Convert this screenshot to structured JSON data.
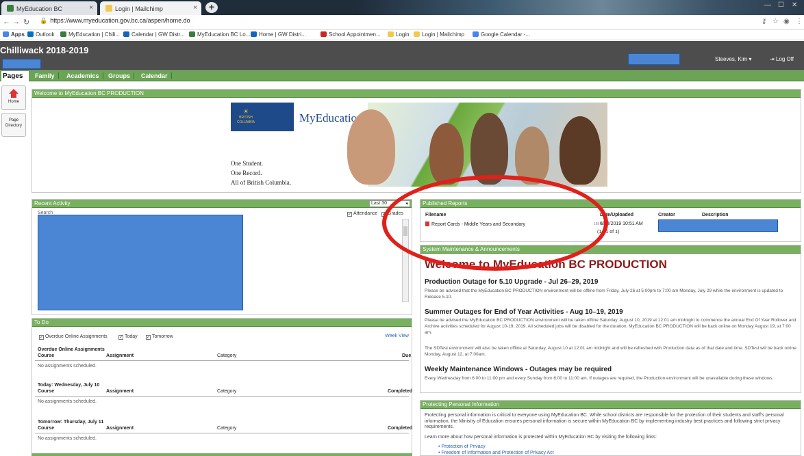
{
  "browser": {
    "tabs": [
      {
        "title": "MyEducation BC"
      },
      {
        "title": "Login | Mailchimp"
      }
    ],
    "url": "https://www.myeducation.gov.bc.ca/aspen/home.do",
    "bookmarks": [
      "Apps",
      "Outlook",
      "MyEducation | Chili...",
      "Calendar | GW Distr...",
      "MyEducation BC Lo...",
      "Home | GW Distri...",
      "School Appointmen...",
      "Login",
      "Login | Mailchimp",
      "Google Calendar -..."
    ]
  },
  "app": {
    "school": "Chilliwack 2018-2019",
    "user": "Steeves, Kim ▾",
    "logoff": "Log Off",
    "pages_label": "Pages",
    "top_tabs": [
      "Family",
      "Academics",
      "Groups",
      "Calendar"
    ],
    "side": {
      "home": "Home",
      "directory_1": "Page",
      "directory_2": "Directory"
    }
  },
  "welcome": {
    "header": "Welcome to MyEducation BC PRODUCTION",
    "brand": "MyEducationBC",
    "logo_text": "BRITISH COLUMBIA",
    "tagline": [
      "One Student.",
      "One Record.",
      "All of British Columbia."
    ]
  },
  "recent": {
    "header": "Recent Activity",
    "select": "Last 30",
    "search": "Search",
    "attendance": "Attendance",
    "grades": "Grades"
  },
  "todo": {
    "header": "To Do",
    "filters": [
      "Overdue Online Assignments",
      "Today",
      "Tomorrow"
    ],
    "week_view": "Week View",
    "sections": [
      {
        "title": "Overdue Online Assignments",
        "cols": [
          "Course",
          "Assignment",
          "Category",
          "Due"
        ],
        "empty": "No assignments scheduled."
      },
      {
        "title": "Today: Wednesday, July 10",
        "cols": [
          "Course",
          "Assignment",
          "Category",
          "Completed"
        ],
        "empty": "No assignments scheduled."
      },
      {
        "title": "Tomorrow: Thursday, July 11",
        "cols": [
          "Course",
          "Assignment",
          "Category",
          "Completed"
        ],
        "empty": "No assignments scheduled."
      }
    ]
  },
  "published": {
    "header": "Published Reports",
    "cols": [
      "Filename",
      "Date/Uploaded",
      "Creator",
      "Description"
    ],
    "file": "Report Cards - Middle Years and Secondary",
    "size": "189 KB",
    "date": "6/28/2019 10:51 AM",
    "count": "(1 - 1 of 1)"
  },
  "announce": {
    "header": "System Maintenance & Announcements",
    "title": "Welcome to MyEducation BC PRODUCTION",
    "items": [
      {
        "h": "Production Outage for 5.10 Upgrade - Jul 26–29, 2019",
        "p": "Please be advised that the MyEducation BC PRODUCTION environment will be offline from Friday, July 26 at 5:00pm to 7:00 am Monday, July 29 while the environment is updated to Release 5.10."
      },
      {
        "h": "Summer Outages for End of Year Activities - Aug 10–19, 2019",
        "p": "Please be advised the MyEducation BC PRODUCTION environment will be taken offline Saturday, August 10, 2019 at 12:01 am midnight to commence the annual End Of Year Rollover and Archive activities scheduled for August 10-19, 2019. All scheduled jobs will be disabled for the duration. MyEducation BC PRODUCTION will be back online on Monday August 19, at 7:00 am.",
        "p2": "The SDTest environment will also be taken offline at Saturday, August 10 at 12:01 am midnight and will be refreshed with Production data as of that date and time. SDTest will be back online Monday, August 12, at 7:00am."
      },
      {
        "h": "Weekly Maintenance Windows - Outages may be required",
        "p": "Every Wednesday from 6:00 to 11:00 pm and every Sunday from 6:00 to 11:00 am. If outages are required, the Production environment will be unavailable during these windows."
      }
    ]
  },
  "privacy": {
    "header": "Protecting Personal Information",
    "p1": "Protecting personal information is critical to everyone using MyEducation BC. While school districts are responsible for the protection of their students and staff's personal information, the Ministry of Education ensures personal information is secure within MyEducation BC by implementing industry best practices and following strict privacy requirements.",
    "p2": "Learn more about how personal information is protected within MyEducation BC by visiting the following links:",
    "links": [
      "Protection of Privacy",
      "Freedom of Information and Protection of Privacy Act"
    ]
  },
  "colors": {
    "green": "#78b05f",
    "redact": "#4a86d4",
    "annotation": "#e0201a",
    "title_red": "#8b1a1a"
  }
}
